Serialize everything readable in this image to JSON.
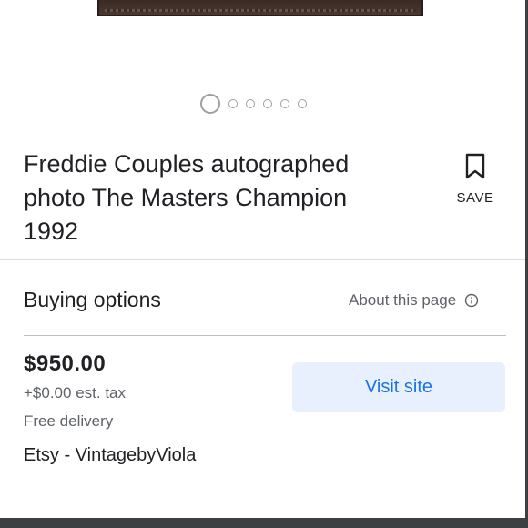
{
  "carousel": {
    "total_images": 6,
    "active_index": 0
  },
  "product": {
    "title": "Freddie Couples autographed photo The Masters Champion 1992"
  },
  "save": {
    "label": "SAVE",
    "icon": "bookmark-icon"
  },
  "buying_options": {
    "heading": "Buying options",
    "about_label": "About this page",
    "about_icon": "info-icon"
  },
  "offer": {
    "price": "$950.00",
    "tax": "+$0.00 est. tax",
    "delivery": "Free delivery",
    "seller": "Etsy - VintagebyViola",
    "visit_label": "Visit site"
  },
  "colors": {
    "accent": "#1a73e8",
    "button_bg": "#e8f0fe",
    "muted_text": "#5f6368"
  }
}
